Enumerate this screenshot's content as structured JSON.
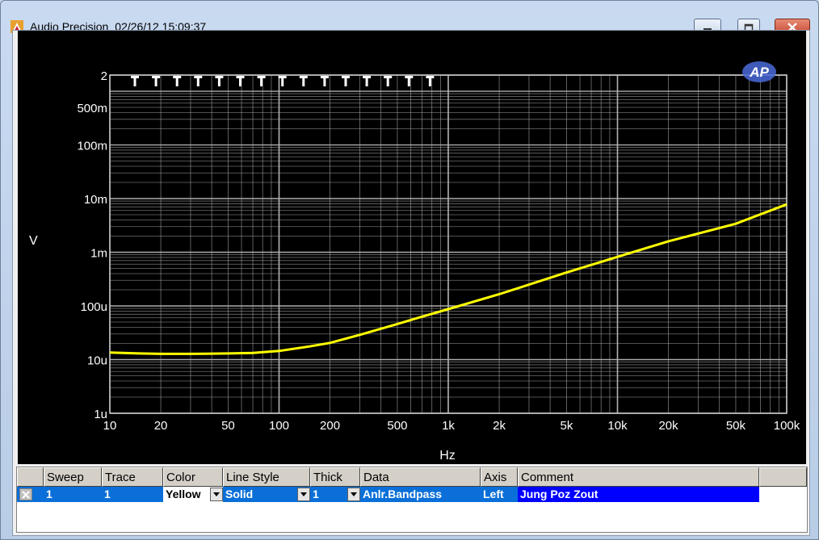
{
  "window": {
    "app_name": "Audio Precision",
    "timestamp": "02/26/12 15:09:37",
    "accent_title": "#c9daf0",
    "close_color": "#c4432b"
  },
  "plot": {
    "y_unit": "V",
    "x_unit": "Hz",
    "logo_text": "AP",
    "background": "#000000",
    "grid_color": "#b4b4b4",
    "trace_color": "#ffff00"
  },
  "chart_data": {
    "type": "line",
    "xlabel": "Hz",
    "ylabel": "V",
    "x_scale": "log",
    "y_scale": "log",
    "xlim": [
      10,
      100000
    ],
    "ylim": [
      1e-06,
      2
    ],
    "grid": true,
    "x_ticks": [
      {
        "value": 10,
        "label": "10"
      },
      {
        "value": 20,
        "label": "20"
      },
      {
        "value": 50,
        "label": "50"
      },
      {
        "value": 100,
        "label": "100"
      },
      {
        "value": 200,
        "label": "200"
      },
      {
        "value": 500,
        "label": "500"
      },
      {
        "value": 1000,
        "label": "1k"
      },
      {
        "value": 2000,
        "label": "2k"
      },
      {
        "value": 5000,
        "label": "5k"
      },
      {
        "value": 10000,
        "label": "10k"
      },
      {
        "value": 20000,
        "label": "20k"
      },
      {
        "value": 50000,
        "label": "50k"
      },
      {
        "value": 100000,
        "label": "100k"
      }
    ],
    "y_ticks": [
      {
        "value": 1e-06,
        "label": "1u"
      },
      {
        "value": 1e-05,
        "label": "10u"
      },
      {
        "value": 0.0001,
        "label": "100u"
      },
      {
        "value": 0.001,
        "label": "1m"
      },
      {
        "value": 0.01,
        "label": "10m"
      },
      {
        "value": 0.1,
        "label": "100m"
      },
      {
        "value": 0.5,
        "label": "500m"
      },
      {
        "value": 2,
        "label": "2"
      }
    ],
    "series": [
      {
        "x": [
          10,
          15,
          20,
          30,
          50,
          70,
          100,
          150,
          200,
          300,
          500,
          700,
          1000,
          2000,
          5000,
          10000,
          20000,
          50000,
          100000
        ],
        "y": [
          1.35e-05,
          1.3e-05,
          1.28e-05,
          1.28e-05,
          1.3e-05,
          1.33e-05,
          1.45e-05,
          1.75e-05,
          2.05e-05,
          2.9e-05,
          4.6e-05,
          6.3e-05,
          8.7e-05,
          0.000165,
          0.00042,
          0.00082,
          0.0016,
          0.0034,
          0.0078
        ]
      }
    ],
    "markers_count": 15
  },
  "table": {
    "columns": [
      "",
      "Sweep",
      "Trace",
      "Color",
      "Line Style",
      "Thick",
      "Data",
      "Axis",
      "Comment"
    ],
    "rows": [
      {
        "sweep": "1",
        "trace": "1",
        "color": "Yellow",
        "line_style": "Solid",
        "thick": "1",
        "data": "Anlr.Bandpass",
        "axis": "Left",
        "comment": "Jung Poz Zout"
      }
    ],
    "selection_color": "#0a6fd8"
  }
}
